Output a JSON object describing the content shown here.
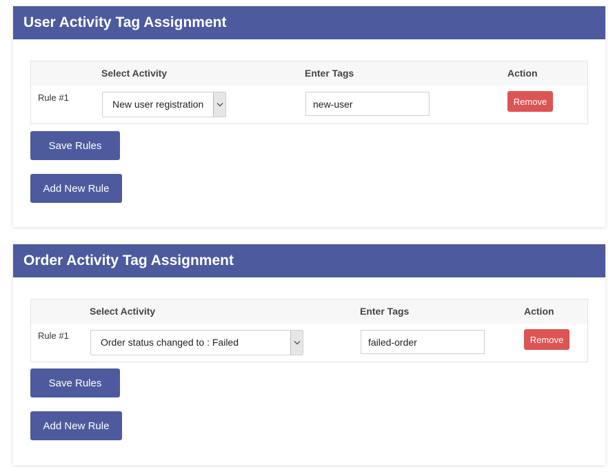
{
  "user_activity": {
    "title": "User Activity Tag Assignment",
    "columns": {
      "activity": "Select Activity",
      "tags": "Enter Tags",
      "action": "Action"
    },
    "rules": [
      {
        "label": "Rule #1",
        "activity": "New user registration",
        "tags": "new-user",
        "remove_label": "Remove"
      }
    ],
    "save_label": "Save Rules",
    "add_label": "Add New Rule"
  },
  "order_activity": {
    "title": "Order Activity Tag Assignment",
    "columns": {
      "activity": "Select Activity",
      "tags": "Enter Tags",
      "action": "Action"
    },
    "rules": [
      {
        "label": "Rule #1",
        "activity": "Order status changed to : Failed",
        "tags": "failed-order",
        "remove_label": "Remove"
      }
    ],
    "save_label": "Save Rules",
    "add_label": "Add New Rule"
  },
  "icons": {
    "select_arrow": "chevron-down-icon"
  },
  "colors": {
    "header": "#4d5b9e",
    "primary_button": "#4d5b9e",
    "remove_button": "#dd5454"
  }
}
